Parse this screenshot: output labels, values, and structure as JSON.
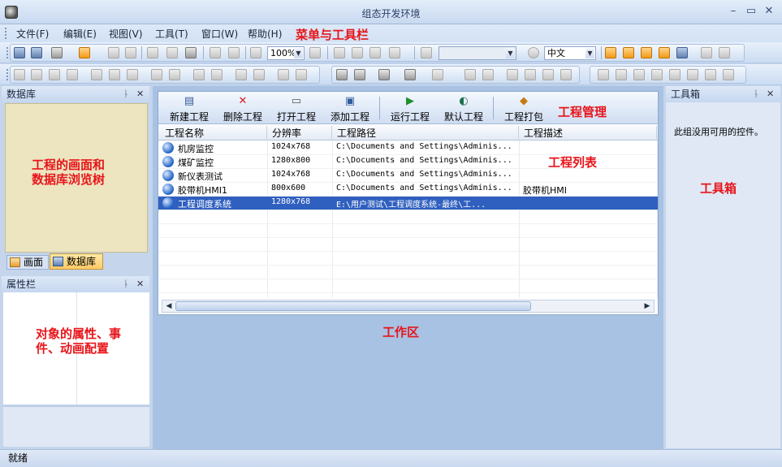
{
  "window": {
    "title": "组态开发环境",
    "controls": {
      "minimize": "–",
      "restore": "▭",
      "close": "✕"
    }
  },
  "menu": {
    "items": [
      "文件(F)",
      "编辑(E)",
      "视图(V)",
      "工具(T)",
      "窗口(W)",
      "帮助(H)"
    ],
    "annotation": "菜单与工具栏"
  },
  "toolbar": {
    "zoom": "100%",
    "language": "中文",
    "font_combo": ""
  },
  "left_panels": {
    "database": {
      "title": "数据库",
      "annotation_line1": "工程的画面和",
      "annotation_line2": "数据库浏览树",
      "tabs": [
        "画面",
        "数据库"
      ]
    },
    "properties": {
      "title": "属性栏",
      "annotation_line1": "对象的属性、事",
      "annotation_line2": "件、动画配置"
    }
  },
  "right_panel": {
    "title": "工具箱",
    "message": "此组没用可用的控件。",
    "annotation": "工具箱"
  },
  "project_manager": {
    "annotation": "工程管理",
    "list_annotation": "工程列表",
    "buttons": [
      "新建工程",
      "删除工程",
      "打开工程",
      "添加工程",
      "运行工程",
      "默认工程",
      "工程打包"
    ],
    "columns": [
      "工程名称",
      "分辨率",
      "工程路径",
      "工程描述"
    ],
    "rows": [
      {
        "name": "机房监控",
        "resolution": "1024x768",
        "path": "C:\\Documents and Settings\\Adminis...",
        "desc": ""
      },
      {
        "name": "煤矿监控",
        "resolution": "1280x800",
        "path": "C:\\Documents and Settings\\Adminis...",
        "desc": ""
      },
      {
        "name": "新仪表测试",
        "resolution": "1024x768",
        "path": "C:\\Documents and Settings\\Adminis...",
        "desc": ""
      },
      {
        "name": "胶带机HMI1",
        "resolution": "800x600",
        "path": "C:\\Documents and Settings\\Adminis...",
        "desc": "胶带机HMI"
      },
      {
        "name": "工程调度系统",
        "resolution": "1280x768",
        "path": "E:\\用户测试\\工程调度系统-最终\\工...",
        "desc": ""
      }
    ],
    "selected_row": 4
  },
  "workspace_annotation": "工作区",
  "status": "就绪"
}
